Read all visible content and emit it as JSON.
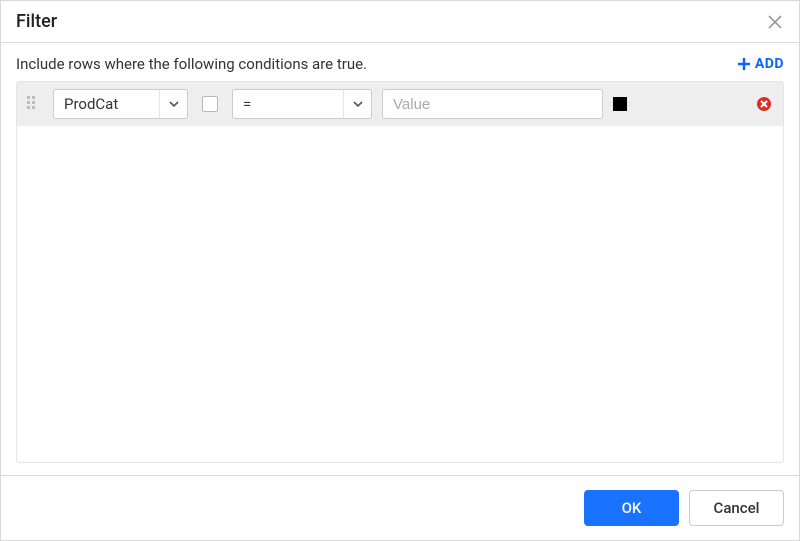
{
  "dialog": {
    "title": "Filter",
    "instruction": "Include rows where the following conditions are true.",
    "add_label": "ADD"
  },
  "condition": {
    "field": "ProdCat",
    "operator": "=",
    "value": "",
    "value_placeholder": "Value",
    "swatch_color": "#000000"
  },
  "footer": {
    "ok_label": "OK",
    "cancel_label": "Cancel"
  }
}
